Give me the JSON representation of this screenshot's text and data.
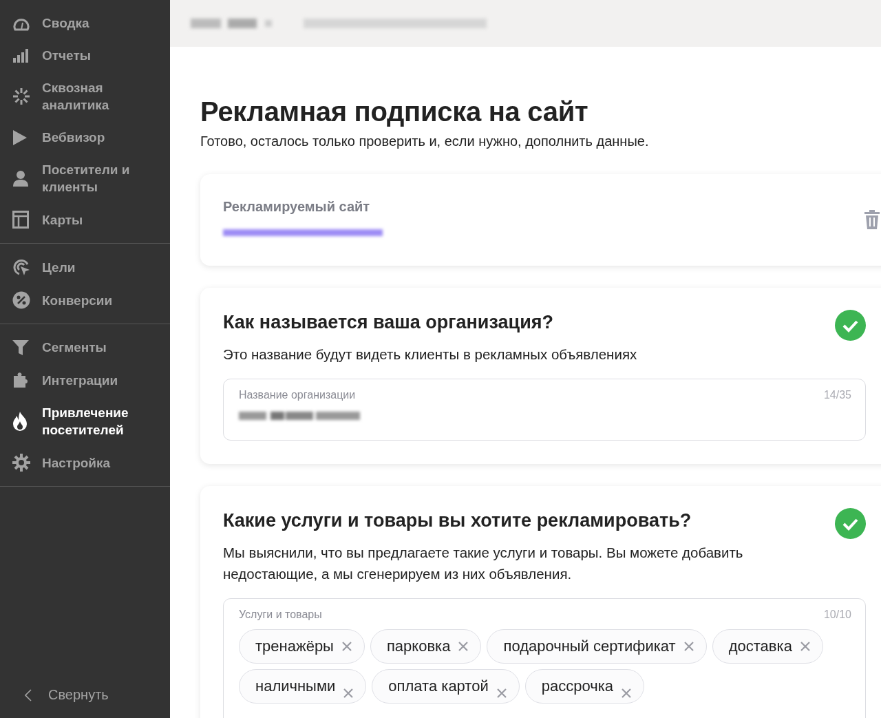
{
  "sidebar": {
    "groups": [
      [
        {
          "label": "Сводка",
          "selected": false
        },
        {
          "label": "Отчеты",
          "selected": false
        },
        {
          "label": "Сквозная аналитика",
          "selected": false
        },
        {
          "label": "Вебвизор",
          "selected": false
        },
        {
          "label": "Посетители и клиенты",
          "selected": false
        },
        {
          "label": "Карты",
          "selected": false
        }
      ],
      [
        {
          "label": "Цели",
          "selected": false
        },
        {
          "label": "Конверсии",
          "selected": false
        }
      ],
      [
        {
          "label": "Сегменты",
          "selected": false
        },
        {
          "label": "Интеграции",
          "selected": false
        },
        {
          "label": "Привлечение посетителей",
          "selected": true
        },
        {
          "label": "Настройка",
          "selected": false
        }
      ]
    ],
    "collapse": "Свернуть"
  },
  "title": "Рекламная подписка на сайт",
  "subtitle": "Готово, осталось только проверить и, если нужно, дополнить данные.",
  "site_card": {
    "label": "Рекламируемый сайт"
  },
  "questions": [
    {
      "title": "Как называется ваша организация?",
      "description": "Это название будут видеть клиенты в рекламных объявлениях",
      "done": true,
      "field": {
        "kind": "text",
        "label": "Название организации",
        "counter": "14/35"
      }
    },
    {
      "title": "Какие услуги и товары вы хотите рекламировать?",
      "description": "Мы выяснили, что вы предлагаете такие услуги и товары. Вы можете добавить недостающие, а мы сгенерируем из них объявления.",
      "done": true,
      "field": {
        "kind": "tags",
        "label": "Услуги и товары",
        "counter": "10/10",
        "tags": [
          {
            "text": "тренажёры",
            "kind": "plain"
          },
          {
            "text": "парковка",
            "kind": "plain"
          },
          {
            "text": "подарочный сертификат",
            "kind": "plain"
          },
          {
            "text": "доставка",
            "kind": "plain"
          },
          {
            "text": "наличными",
            "kind": "noted"
          },
          {
            "text": "оплата картой",
            "kind": "noted"
          },
          {
            "text": "рассрочка",
            "kind": "noted"
          }
        ]
      }
    }
  ]
}
